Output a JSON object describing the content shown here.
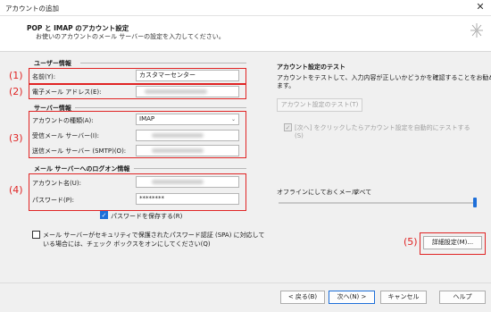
{
  "window": {
    "title": "アカウントの追加",
    "close_glyph": "✕"
  },
  "header": {
    "title": "POP と IMAP のアカウント設定",
    "subtitle": "お使いのアカウントのメール サーバーの設定を入力してください。"
  },
  "markers": [
    "(1)",
    "(2)",
    "(3)",
    "(4)",
    "(5)"
  ],
  "user_info": {
    "heading": "ユーザー情報",
    "name_label": "名前(Y):",
    "name_value": "カスタマーセンター",
    "email_label": "電子メール アドレス(E):"
  },
  "server_info": {
    "heading": "サーバー情報",
    "account_type_label": "アカウントの種類(A):",
    "account_type_value": "IMAP",
    "incoming_label": "受信メール サーバー(I):",
    "outgoing_label": "送信メール サーバー (SMTP)(O):"
  },
  "logon_info": {
    "heading": "メール サーバーへのログオン情報",
    "account_name_label": "アカウント名(U):",
    "password_label": "パスワード(P):",
    "password_value": "********",
    "save_password_label": "パスワードを保存する(R)",
    "save_password_checked": true,
    "spa_label_line1": "メール サーバーがセキュリティで保護されたパスワード認証 (SPA) に対応して",
    "spa_label_line2": "いる場合には、チェック ボックスをオンにしてください(Q)",
    "spa_checked": false
  },
  "test_panel": {
    "heading": "アカウント設定のテスト",
    "desc_line1": "アカウントをテストして、入力内容が正しいかどうかを確認することをお勧めし",
    "desc_line2": "ます。",
    "test_button": "アカウント設定のテスト(T)",
    "auto_test_line1": "[次へ] をクリックしたらアカウント設定を自動的にテストする",
    "auto_test_line2": "(S)",
    "offline_label": "オフラインにしておくメール:",
    "offline_value": "すべて",
    "offline_level": 1.0
  },
  "buttons": {
    "advanced": "詳細設定(M)...",
    "back": "< 戻る(B)",
    "next": "次へ(N) >",
    "cancel": "キャンセル",
    "help": "ヘルプ"
  },
  "colors": {
    "accent": "#1e6fd9",
    "marker_red": "#e02424"
  },
  "icons": {
    "header_decoration": "sparkle-icon",
    "close": "close-icon",
    "dropdown": "chevron-down-icon"
  }
}
